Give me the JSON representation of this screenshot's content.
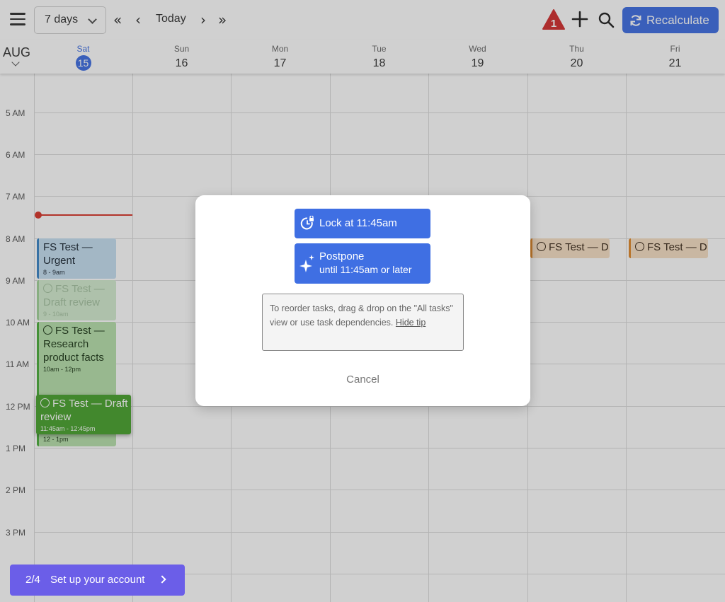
{
  "toolbar": {
    "range_label": "7 days",
    "today_label": "Today",
    "recalculate_label": "Recalculate",
    "alert_count": "1"
  },
  "calendar": {
    "month": "AUG",
    "days": [
      {
        "name": "Sat",
        "num": "15",
        "today": true
      },
      {
        "name": "Sun",
        "num": "16"
      },
      {
        "name": "Mon",
        "num": "17"
      },
      {
        "name": "Tue",
        "num": "18"
      },
      {
        "name": "Wed",
        "num": "19"
      },
      {
        "name": "Thu",
        "num": "20"
      },
      {
        "name": "Fri",
        "num": "21"
      }
    ],
    "hours": [
      "5 AM",
      "6 AM",
      "7 AM",
      "8 AM",
      "9 AM",
      "10 AM",
      "11 AM",
      "12 PM",
      "1 PM",
      "2 PM",
      "3 PM"
    ],
    "events": {
      "urgent_title": "FS Test — Urgent",
      "urgent_time": "8 - 9am",
      "draft_ghost_title": "FS Test — Draft review",
      "draft_ghost_time": "9 - 10am",
      "research_title": "FS Test — Research product facts",
      "research_time": "10am - 12pm",
      "draft_drag_title": "FS Test — Draft review",
      "draft_drag_time": "11:45am - 12:45pm",
      "under_time": "12 - 1pm",
      "thu_title": "FS Test — D",
      "fri_title": "FS Test — D"
    }
  },
  "modal": {
    "lock_label": "Lock at 11:45am",
    "postpone_label": "Postpone",
    "postpone_sub": "until 11:45am or later",
    "tip_text": "To reorder tasks, drag & drop on the \"All tasks\" view or use task dependencies.",
    "hide_tip_label": "Hide tip",
    "cancel_label": "Cancel"
  },
  "setup": {
    "progress": "2/4",
    "label": "Set up your account"
  },
  "colors": {
    "accent": "#3f6fe3",
    "now_line": "#d9362b",
    "setup_bg": "#6b5ee8",
    "warning": "#d32f2f"
  }
}
